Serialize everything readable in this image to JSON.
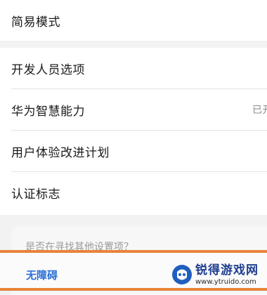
{
  "settings": {
    "simple_mode": "简易模式",
    "developer_options": "开发人员选项",
    "huawei_smart": "华为智慧能力",
    "huawei_smart_value": "已开",
    "ux_improvement": "用户体验改进计划",
    "certification": "认证标志"
  },
  "suggestions": {
    "title": "是否在寻找其他设置项？",
    "accessibility": "无障碍"
  },
  "watermark": {
    "title": "锐得游戏网",
    "url": "www.ytruido.com"
  },
  "colors": {
    "highlight": "#e8843a",
    "link": "#2b6fd6"
  }
}
